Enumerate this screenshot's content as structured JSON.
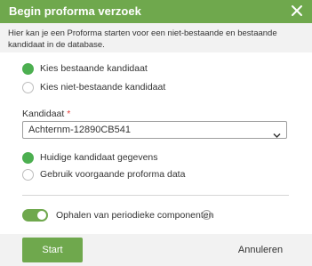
{
  "dialog": {
    "title": "Begin proforma verzoek",
    "description": "Hier kan je een Proforma starten voor een niet-bestaande en bestaande kandidaat in de database."
  },
  "candidate_choice": {
    "options": [
      {
        "label": "Kies bestaande kandidaat",
        "checked": true
      },
      {
        "label": "Kies niet-bestaande kandidaat",
        "checked": false
      }
    ]
  },
  "candidate_field": {
    "label": "Kandidaat",
    "required_mark": "*",
    "value": "Achternm-12890CB541"
  },
  "data_choice": {
    "options": [
      {
        "label": "Huidige kandidaat gegevens",
        "checked": true
      },
      {
        "label": "Gebruik voorgaande proforma data",
        "checked": false
      }
    ]
  },
  "periodic_toggle": {
    "label": "Ophalen van periodieke componenten",
    "on": true,
    "info_icon": "info-icon"
  },
  "footer": {
    "start_label": "Start",
    "cancel_label": "Annuleren"
  },
  "colors": {
    "accent": "#6fa84d",
    "radio_checked": "#4caf50",
    "required": "#e53935"
  }
}
